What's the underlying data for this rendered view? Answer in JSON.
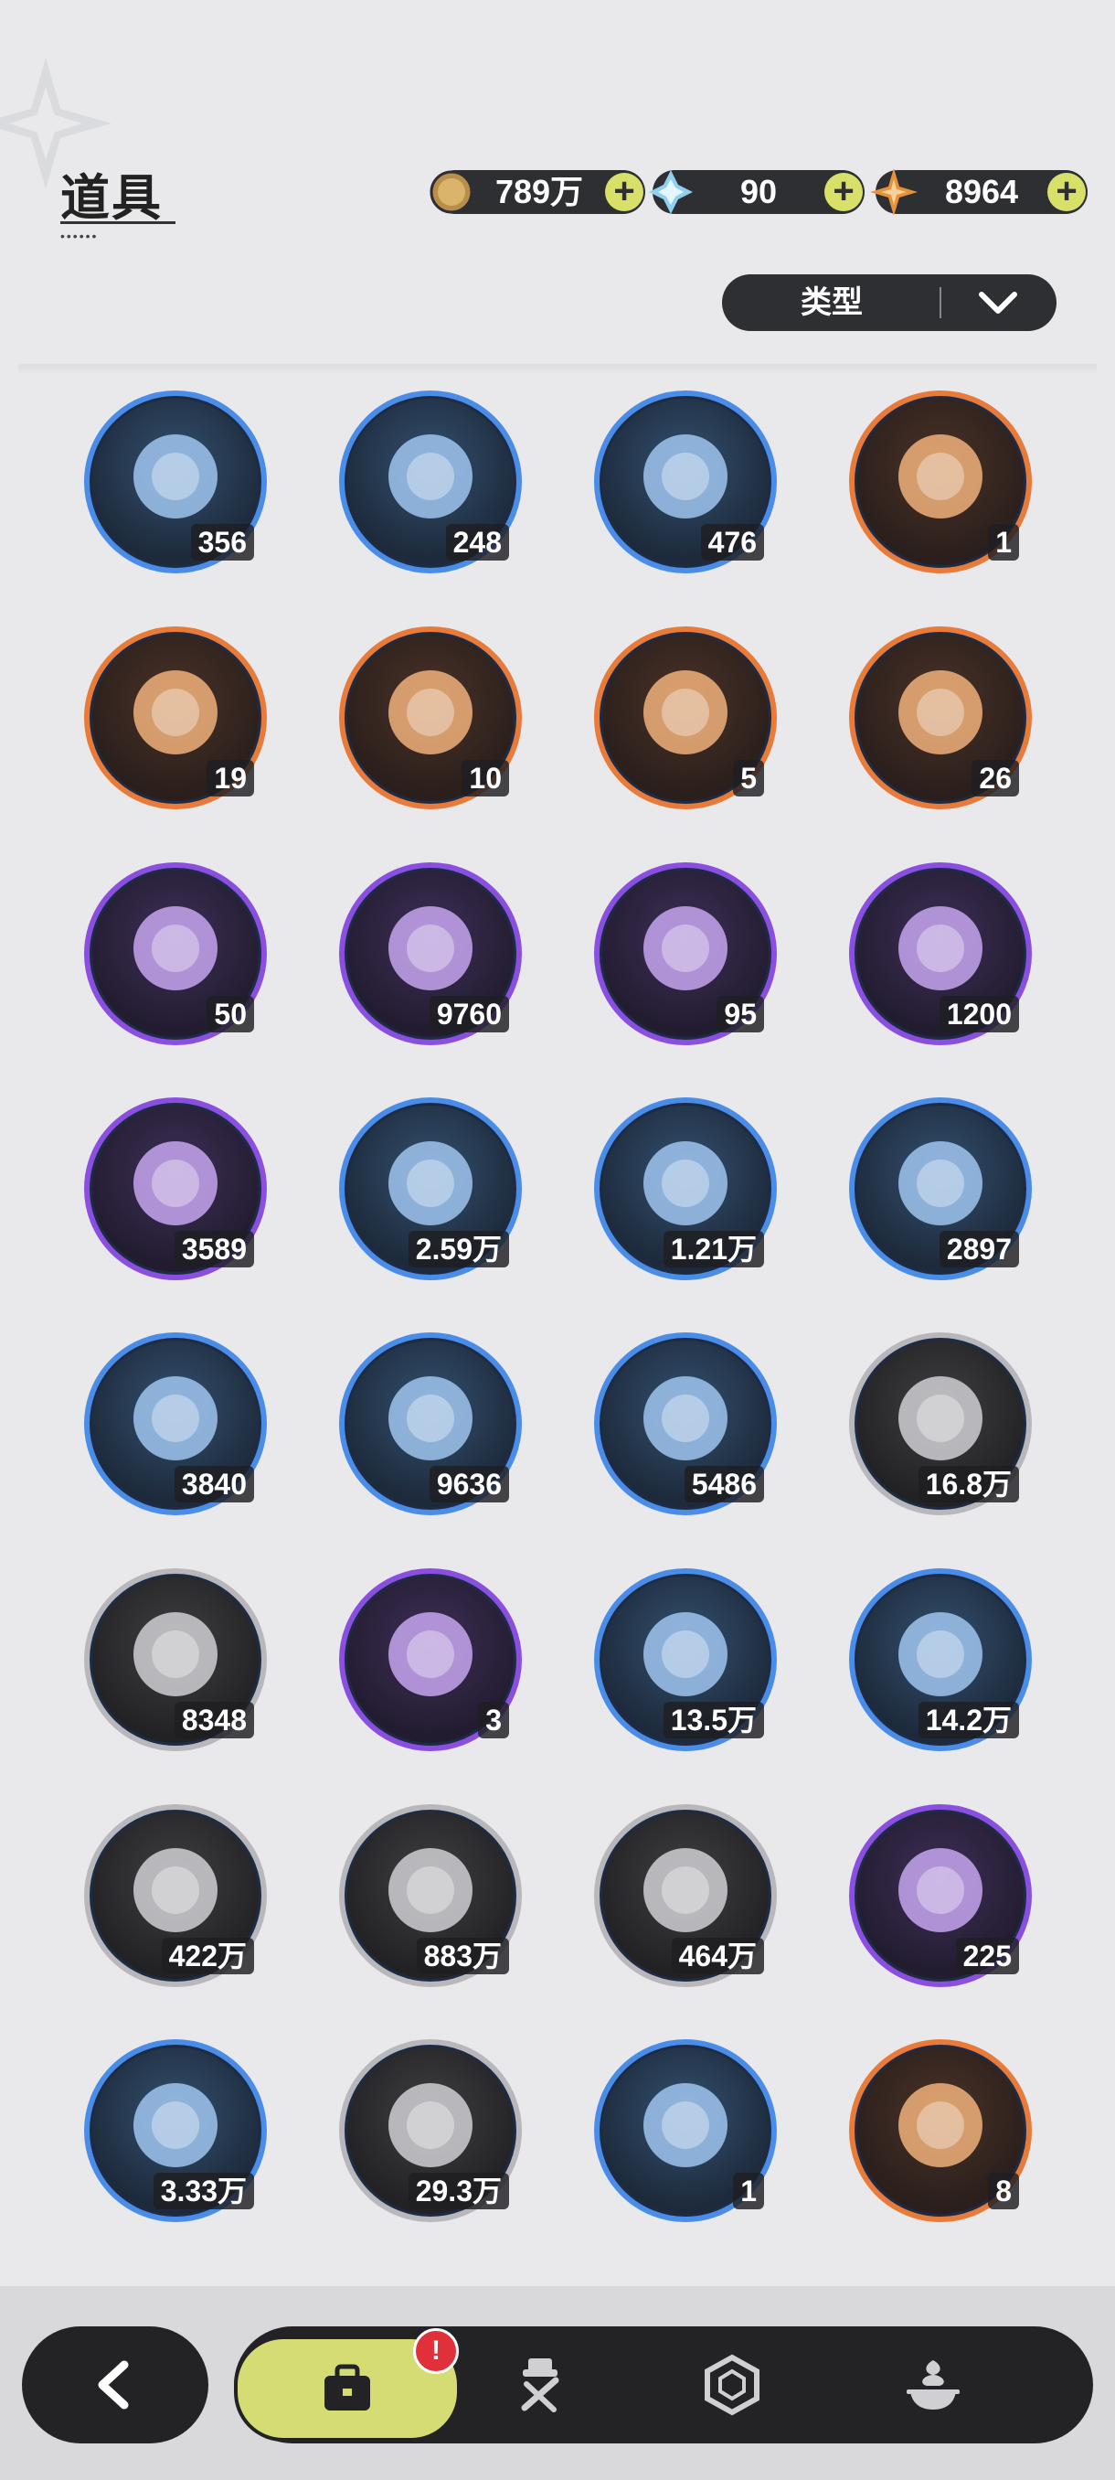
{
  "header": {
    "title": "道具"
  },
  "currencies": [
    {
      "icon": "gold-coin-icon",
      "value": "789万"
    },
    {
      "icon": "blue-crystal-icon",
      "value": "90"
    },
    {
      "icon": "orange-star-icon",
      "value": "8964"
    }
  ],
  "filter": {
    "label": "类型"
  },
  "items": [
    {
      "icon": "boxing-glove-icon",
      "rarity": "blue",
      "count": "356"
    },
    {
      "icon": "pickaxe-icon",
      "rarity": "blue",
      "count": "248"
    },
    {
      "icon": "hammer-icon",
      "rarity": "blue",
      "count": "476"
    },
    {
      "icon": "golden-key-icon",
      "rarity": "orange",
      "count": "1"
    },
    {
      "icon": "pink-gem-heart-icon",
      "rarity": "orange",
      "count": "19"
    },
    {
      "icon": "shirt-token-icon",
      "rarity": "orange",
      "count": "10"
    },
    {
      "icon": "red-ticket-icon",
      "rarity": "orange",
      "count": "5"
    },
    {
      "icon": "rainbow-ticket-icon",
      "rarity": "orange",
      "count": "26"
    },
    {
      "icon": "gold-flower-coin-icon",
      "rarity": "purple",
      "count": "50"
    },
    {
      "icon": "blue-star-orb-icon",
      "rarity": "purple",
      "count": "9760"
    },
    {
      "icon": "fist-coin-icon",
      "rarity": "purple",
      "count": "95"
    },
    {
      "icon": "blue-emblem-coin-icon",
      "rarity": "purple",
      "count": "1200"
    },
    {
      "icon": "heart-coin-icon",
      "rarity": "purple",
      "count": "3589"
    },
    {
      "icon": "bunny-card-icon",
      "rarity": "blue",
      "count": "2.59万"
    },
    {
      "icon": "silver-coin-icon",
      "rarity": "blue",
      "count": "1.21万"
    },
    {
      "icon": "golden-blade-icon",
      "rarity": "blue",
      "count": "2897"
    },
    {
      "icon": "scale-shield-icon",
      "rarity": "blue",
      "count": "3840"
    },
    {
      "icon": "gear-icon",
      "rarity": "blue",
      "count": "9636"
    },
    {
      "icon": "golden-leaf-icon",
      "rarity": "blue",
      "count": "5486"
    },
    {
      "icon": "wood-logs-icon",
      "rarity": "gray",
      "count": "16.8万"
    },
    {
      "icon": "stone-bricks-icon",
      "rarity": "gray",
      "count": "8348"
    },
    {
      "icon": "gold-crystal-icon",
      "rarity": "purple",
      "count": "3"
    },
    {
      "icon": "gold-dust-pile-icon",
      "rarity": "blue",
      "count": "13.5万"
    },
    {
      "icon": "red-crystal-icon",
      "rarity": "blue",
      "count": "14.2万"
    },
    {
      "icon": "sand-pile-icon",
      "rarity": "gray",
      "count": "422万"
    },
    {
      "icon": "dark-crystal-icon",
      "rarity": "gray",
      "count": "883万"
    },
    {
      "icon": "purple-orb-icon",
      "rarity": "gray",
      "count": "464万"
    },
    {
      "icon": "pink-treat-bag-icon",
      "rarity": "purple",
      "count": "225"
    },
    {
      "icon": "blue-treat-bag-icon",
      "rarity": "blue",
      "count": "3.33万"
    },
    {
      "icon": "brown-treat-bag-icon",
      "rarity": "gray",
      "count": "29.3万"
    },
    {
      "icon": "gray-broom-icon",
      "rarity": "blue",
      "count": "1"
    },
    {
      "icon": "flower-bouquet-icon",
      "rarity": "orange",
      "count": "8"
    }
  ],
  "bottom_nav": {
    "back_icon": "back-arrow-icon",
    "tabs": [
      {
        "icon": "bag-icon",
        "active": true,
        "badge": "!"
      },
      {
        "icon": "tools-icon",
        "active": false
      },
      {
        "icon": "hexagon-gem-icon",
        "active": false
      },
      {
        "icon": "dessert-icon",
        "active": false
      }
    ]
  }
}
